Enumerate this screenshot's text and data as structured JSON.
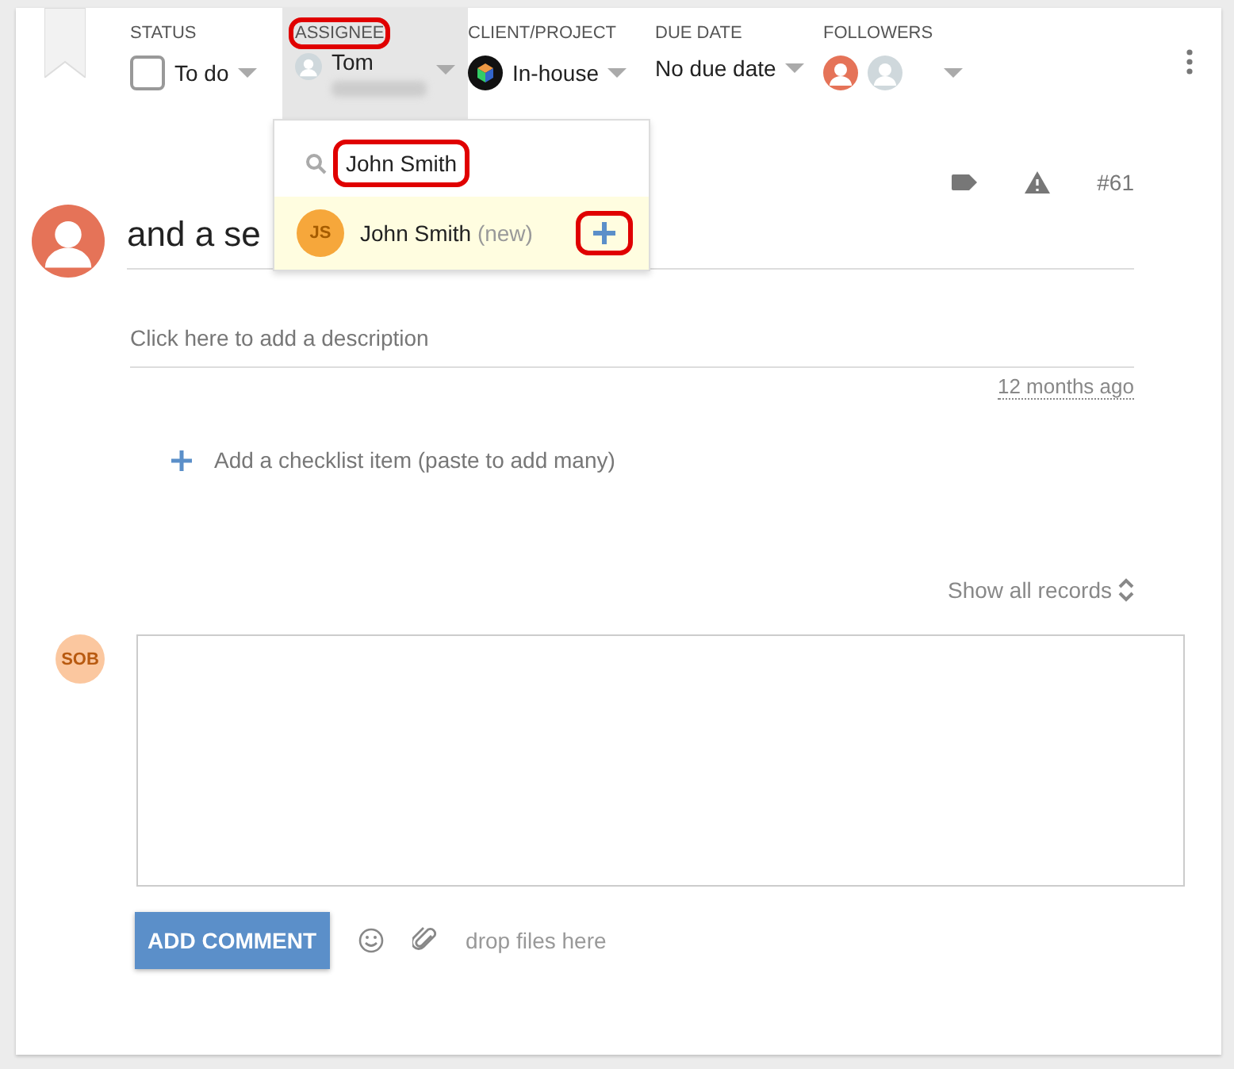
{
  "header": {
    "fields": [
      {
        "kind": "status",
        "label": "STATUS",
        "value": "To do",
        "checked": false,
        "open": false,
        "highlighted": false
      },
      {
        "kind": "assignee",
        "label": "ASSIGNEE",
        "value": "Tom",
        "open": true,
        "highlighted": true
      },
      {
        "kind": "client",
        "label": "CLIENT/PROJECT",
        "value": "In-house",
        "open": false,
        "highlighted": false
      },
      {
        "kind": "due",
        "label": "DUE DATE",
        "value": "No due date",
        "open": false,
        "highlighted": false
      },
      {
        "kind": "followers",
        "label": "FOLLOWERS",
        "open": false,
        "highlighted": false
      }
    ]
  },
  "assignee_dropdown": {
    "search": {
      "value": "John Smith",
      "highlighted": true
    },
    "options": [
      {
        "initials": "JS",
        "name": "John Smith",
        "note": "(new)",
        "add_highlighted": true
      }
    ]
  },
  "task": {
    "number": "#61",
    "title": "and a se",
    "description": {
      "placeholder": "Click here to add a description"
    },
    "updated": "12 months ago",
    "checklist": {
      "placeholder": "Add a checklist item (paste to add many)"
    }
  },
  "records": {
    "toggle": "Show all records"
  },
  "comment": {
    "author_initials": "SOB",
    "button": "ADD COMMENT",
    "drop_hint": "drop files here"
  }
}
